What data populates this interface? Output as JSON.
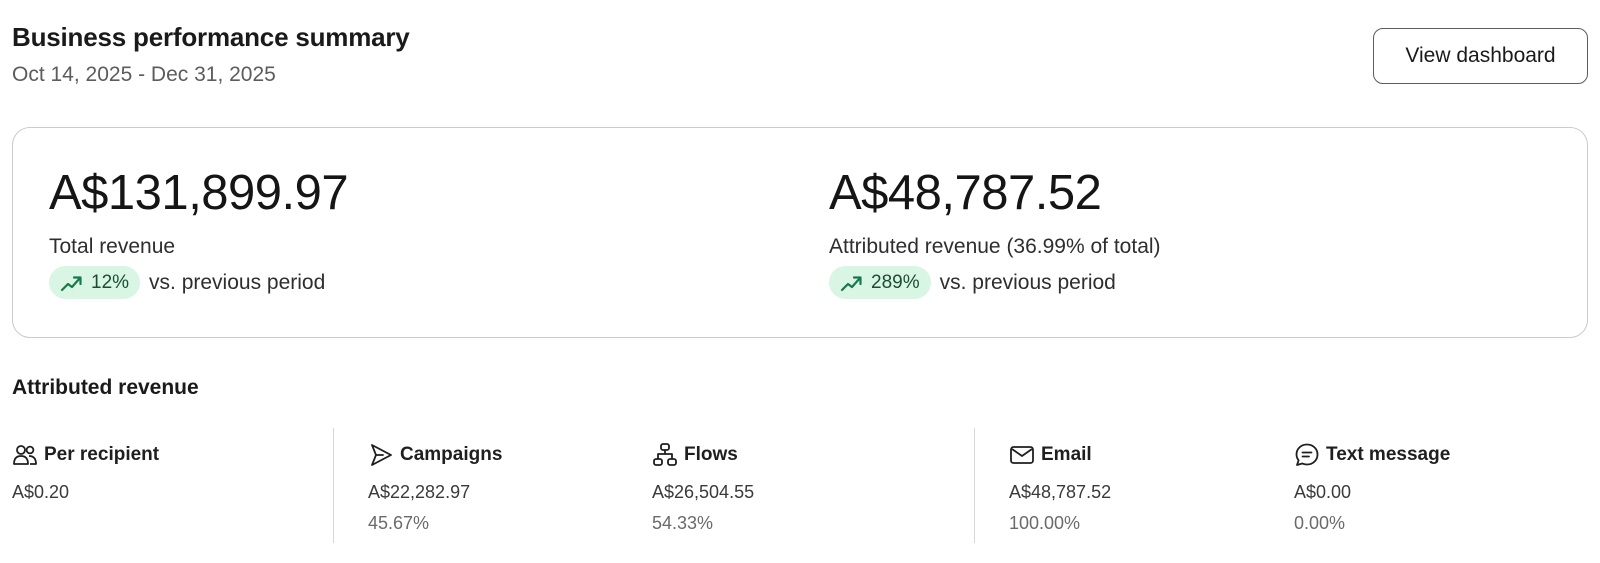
{
  "header": {
    "title": "Business performance summary",
    "date_range": "Oct 14, 2025 - Dec 31, 2025",
    "view_button_label": "View dashboard"
  },
  "summary": {
    "total": {
      "value": "A$131,899.97",
      "label": "Total revenue",
      "change": "12%",
      "change_suffix": "vs. previous period",
      "trend_icon": "trending-up-icon"
    },
    "attributed": {
      "value": "A$48,787.52",
      "label": "Attributed revenue (36.99% of total)",
      "change": "289%",
      "change_suffix": "vs. previous period",
      "trend_icon": "trending-up-icon"
    }
  },
  "attributed_section": {
    "title": "Attributed revenue",
    "items": [
      {
        "label": "Per recipient",
        "icon": "users-icon",
        "value": "A$0.20",
        "percent": ""
      },
      {
        "label": "Campaigns",
        "icon": "send-icon",
        "value": "A$22,282.97",
        "percent": "45.67%"
      },
      {
        "label": "Flows",
        "icon": "flow-icon",
        "value": "A$26,504.55",
        "percent": "54.33%"
      },
      {
        "label": "Email",
        "icon": "mail-icon",
        "value": "A$48,787.52",
        "percent": "100.00%"
      },
      {
        "label": "Text message",
        "icon": "message-icon",
        "value": "A$0.00",
        "percent": "0.00%"
      }
    ]
  },
  "colors": {
    "badge_bg": "#d9f5e3",
    "trend_green": "#177a4b",
    "card_border": "#c7ccd3"
  }
}
